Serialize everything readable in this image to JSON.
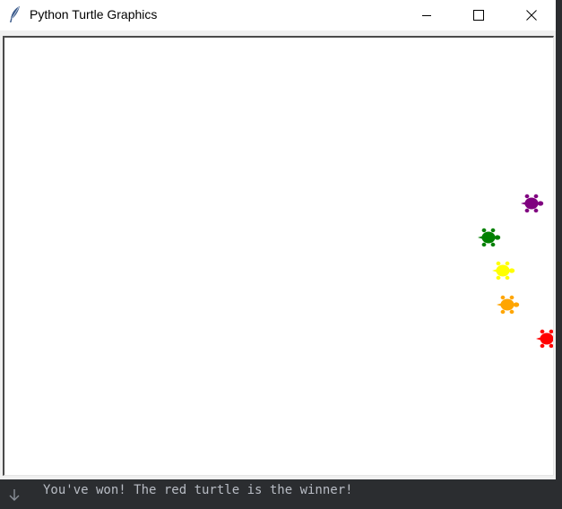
{
  "window": {
    "title": "Python Turtle Graphics",
    "icon": "feather-icon",
    "buttons": {
      "minimize": "minimize-icon",
      "maximize": "maximize-icon",
      "close": "close-icon"
    }
  },
  "canvas": {
    "background": "#ffffff",
    "turtles": [
      {
        "color": "purple",
        "hex": "#800080"
      },
      {
        "color": "green",
        "hex": "#008000"
      },
      {
        "color": "yellow",
        "hex": "#ffff00"
      },
      {
        "color": "orange",
        "hex": "#ffa500"
      },
      {
        "color": "red",
        "hex": "#ff0000"
      }
    ]
  },
  "console": {
    "icon": "arrow-down-icon",
    "message": "You've won! The red turtle is the winner!"
  }
}
